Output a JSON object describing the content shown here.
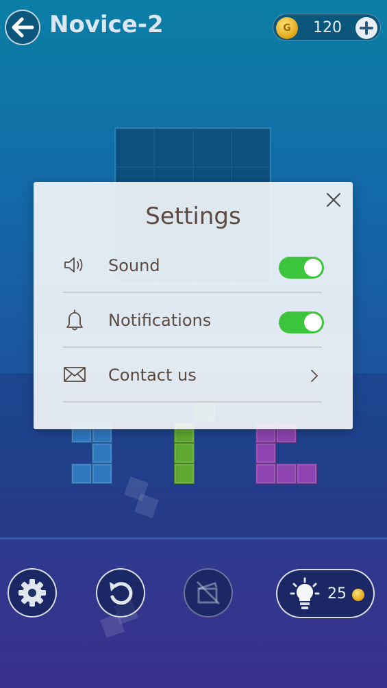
{
  "header": {
    "level_title": "Novice-2",
    "coins": "120",
    "coin_symbol": "G"
  },
  "settings": {
    "title": "Settings",
    "items": [
      {
        "label": "Sound",
        "icon": "speaker-icon",
        "control": "toggle",
        "on": true
      },
      {
        "label": "Notifications",
        "icon": "bell-icon",
        "control": "toggle",
        "on": true
      },
      {
        "label": "Contact us",
        "icon": "envelope-icon",
        "control": "chevron"
      }
    ]
  },
  "toolbar": {
    "hint_count": "25"
  },
  "colors": {
    "toggle_on": "#3cc43c",
    "piece_blue": "#2f78c0",
    "piece_green": "#5fa830",
    "piece_purple": "#8e44b0"
  }
}
